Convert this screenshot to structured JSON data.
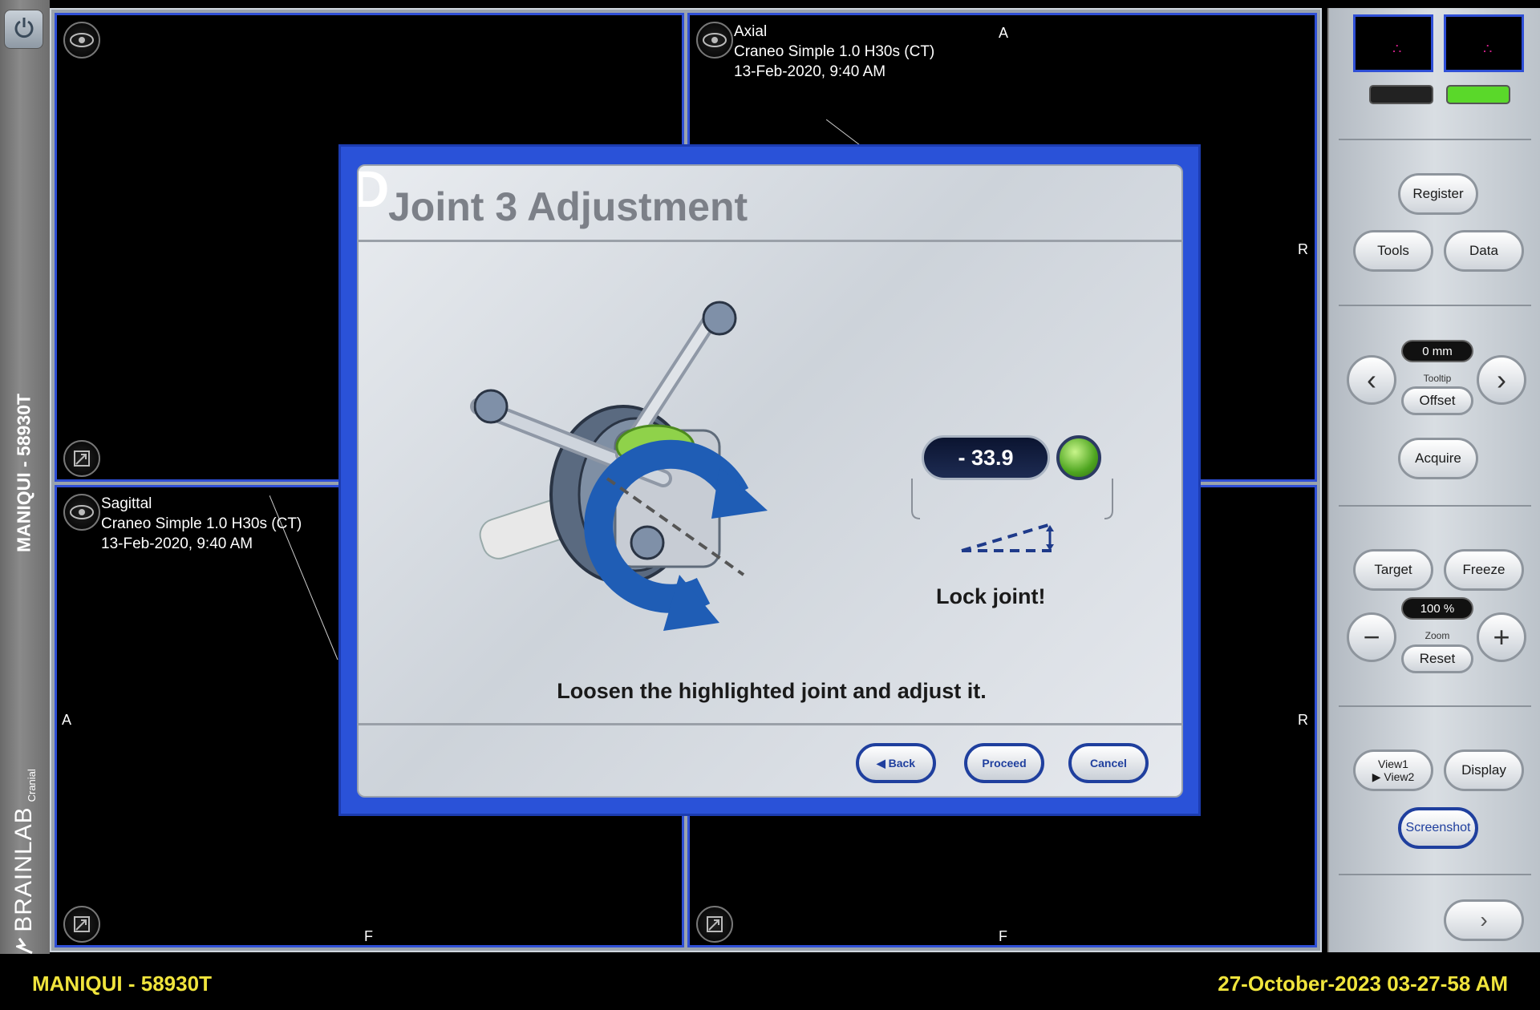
{
  "app": {
    "patient_vertical": "MANIQUI - 58930T",
    "brand": "BRAINLAB",
    "brand_sub": "Cranial"
  },
  "panes": {
    "axial": {
      "name": "Axial",
      "series": "Craneo Simple  1.0  H30s (CT)",
      "date": "13-Feb-2020, 9:40 AM",
      "top_label": "A",
      "right_label": "R",
      "bottom_label": "F"
    },
    "sagittal": {
      "name": "Sagittal",
      "series": "Craneo Simple  1.0  H30s (CT)",
      "date": "13-Feb-2020, 9:40 AM",
      "left_label": "A",
      "bottom_label": "F"
    },
    "bottom_right": {
      "right_label": "R",
      "bottom_label": "F"
    }
  },
  "dialog": {
    "step_letter": "D",
    "title": "Joint 3 Adjustment",
    "value": "- 33.9",
    "status_color": "#4ea520",
    "lock_text": "Lock joint!",
    "instruction": "Loosen the highlighted joint and adjust it.",
    "back_label": "◀ Back",
    "proceed_label": "Proceed",
    "cancel_label": "Cancel"
  },
  "right_panel": {
    "status_bars": [
      "#222222",
      "#5ad82a"
    ],
    "register": "Register",
    "tools": "Tools",
    "data": "Data",
    "offset_value": "0 mm",
    "tooltip_label": "Tooltip",
    "offset_button": "Offset",
    "acquire": "Acquire",
    "target": "Target",
    "freeze": "Freeze",
    "zoom_value": "100 %",
    "zoom_label": "Zoom",
    "reset": "Reset",
    "view_toggle_line1": "View1",
    "view_toggle_line2": "▶ View2",
    "display": "Display",
    "screenshot": "Screenshot"
  },
  "status_bar": {
    "patient": "MANIQUI - 58930T",
    "datetime": "27-October-2023  03-27-58 AM"
  }
}
